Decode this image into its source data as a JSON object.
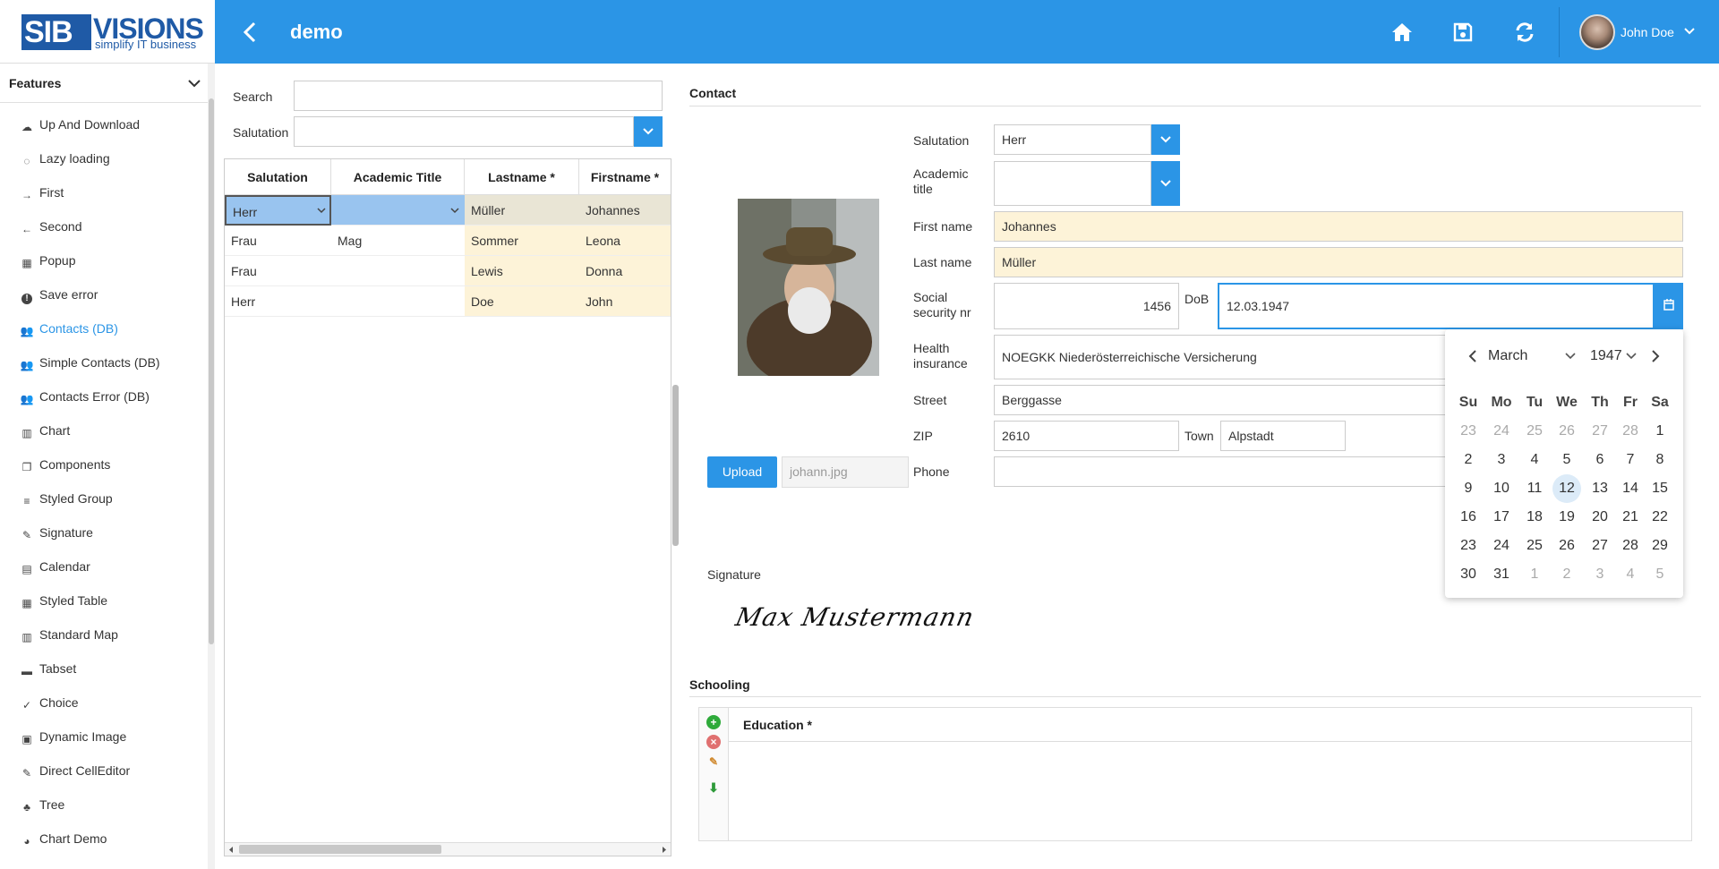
{
  "header": {
    "logo_main": "SIBVISIONS",
    "logo_sib": "SIB",
    "logo_visions": "VISIONS",
    "logo_tagline": "simplify IT business",
    "title": "demo",
    "user_name": "John Doe",
    "accent_color": "#2b95e6",
    "icons": [
      "back-icon",
      "home-icon",
      "save-icon",
      "reload-icon",
      "chevron-down-icon"
    ]
  },
  "sidebar": {
    "heading": "Features",
    "items": [
      {
        "label": "Up And Download",
        "icon": "cloud-icon"
      },
      {
        "label": "Lazy loading",
        "icon": "spinner-icon"
      },
      {
        "label": "First",
        "icon": "arrow-right-icon"
      },
      {
        "label": "Second",
        "icon": "arrow-left-icon"
      },
      {
        "label": "Popup",
        "icon": "windows-icon"
      },
      {
        "label": "Save error",
        "icon": "exclamation-icon"
      },
      {
        "label": "Contacts (DB)",
        "icon": "users-icon",
        "active": true
      },
      {
        "label": "Simple Contacts (DB)",
        "icon": "users-icon"
      },
      {
        "label": "Contacts Error (DB)",
        "icon": "users-icon"
      },
      {
        "label": "Chart",
        "icon": "bar-chart-icon"
      },
      {
        "label": "Components",
        "icon": "copy-icon"
      },
      {
        "label": "Styled Group",
        "icon": "list-icon"
      },
      {
        "label": "Signature",
        "icon": "edit-icon"
      },
      {
        "label": "Calendar",
        "icon": "calendar-icon"
      },
      {
        "label": "Styled Table",
        "icon": "table-icon"
      },
      {
        "label": "Standard Map",
        "icon": "map-icon"
      },
      {
        "label": "Tabset",
        "icon": "folder-icon"
      },
      {
        "label": "Choice",
        "icon": "check-icon"
      },
      {
        "label": "Dynamic Image",
        "icon": "image-icon"
      },
      {
        "label": "Direct CellEditor",
        "icon": "edit-icon"
      },
      {
        "label": "Tree",
        "icon": "tree-icon"
      },
      {
        "label": "Chart Demo",
        "icon": "pie-chart-icon"
      }
    ]
  },
  "filter": {
    "search_label": "Search",
    "search_value": "",
    "salutation_label": "Salutation",
    "salutation_value": ""
  },
  "table": {
    "columns": [
      "Salutation",
      "Academic Title",
      "Lastname *",
      "Firstname *"
    ],
    "rows": [
      [
        "Herr",
        "",
        "Müller",
        "Johannes"
      ],
      [
        "Frau",
        "Mag",
        "Sommer",
        "Leona"
      ],
      [
        "Frau",
        "",
        "Lewis",
        "Donna"
      ],
      [
        "Herr",
        "",
        "Doe",
        "John"
      ]
    ],
    "selected_row": 0
  },
  "contact": {
    "section_title": "Contact",
    "salutation_label": "Salutation",
    "salutation_value": "Herr",
    "academic_title_label": "Academic title",
    "academic_title_value": "",
    "first_name_label": "First name",
    "first_name_value": "Johannes",
    "last_name_label": "Last name",
    "last_name_value": "Müller",
    "ssn_label": "Social security nr",
    "ssn_value": "1456",
    "dob_label": "DoB",
    "dob_value": "12.03.1947",
    "health_label": "Health insurance",
    "health_value": "NOEGKK Niederösterreichische Versicherung",
    "street_label": "Street",
    "street_value": "Berggasse",
    "zip_label": "ZIP",
    "zip_value": "2610",
    "town_label": "Town",
    "town_value": "Alpstadt",
    "phone_label": "Phone",
    "phone_value": "",
    "upload_label": "Upload",
    "file_name": "johann.jpg",
    "signature_label": "Signature",
    "signature_text": "Max Mustermann"
  },
  "calendar": {
    "month": "March",
    "year": "1947",
    "weekdays": [
      "Su",
      "Mo",
      "Tu",
      "We",
      "Th",
      "Fr",
      "Sa"
    ],
    "weeks": [
      [
        {
          "d": "23",
          "o": true
        },
        {
          "d": "24",
          "o": true
        },
        {
          "d": "25",
          "o": true
        },
        {
          "d": "26",
          "o": true
        },
        {
          "d": "27",
          "o": true
        },
        {
          "d": "28",
          "o": true
        },
        {
          "d": "1"
        }
      ],
      [
        {
          "d": "2"
        },
        {
          "d": "3"
        },
        {
          "d": "4"
        },
        {
          "d": "5"
        },
        {
          "d": "6"
        },
        {
          "d": "7"
        },
        {
          "d": "8"
        }
      ],
      [
        {
          "d": "9"
        },
        {
          "d": "10"
        },
        {
          "d": "11"
        },
        {
          "d": "12",
          "s": true
        },
        {
          "d": "13"
        },
        {
          "d": "14"
        },
        {
          "d": "15"
        }
      ],
      [
        {
          "d": "16"
        },
        {
          "d": "17"
        },
        {
          "d": "18"
        },
        {
          "d": "19"
        },
        {
          "d": "20"
        },
        {
          "d": "21"
        },
        {
          "d": "22"
        }
      ],
      [
        {
          "d": "23"
        },
        {
          "d": "24"
        },
        {
          "d": "25"
        },
        {
          "d": "26"
        },
        {
          "d": "27"
        },
        {
          "d": "28"
        },
        {
          "d": "29"
        }
      ],
      [
        {
          "d": "30"
        },
        {
          "d": "31"
        },
        {
          "d": "1",
          "o": true
        },
        {
          "d": "2",
          "o": true
        },
        {
          "d": "3",
          "o": true
        },
        {
          "d": "4",
          "o": true
        },
        {
          "d": "5",
          "o": true
        }
      ]
    ]
  },
  "schooling": {
    "section_title": "Schooling",
    "column": "Education *"
  }
}
